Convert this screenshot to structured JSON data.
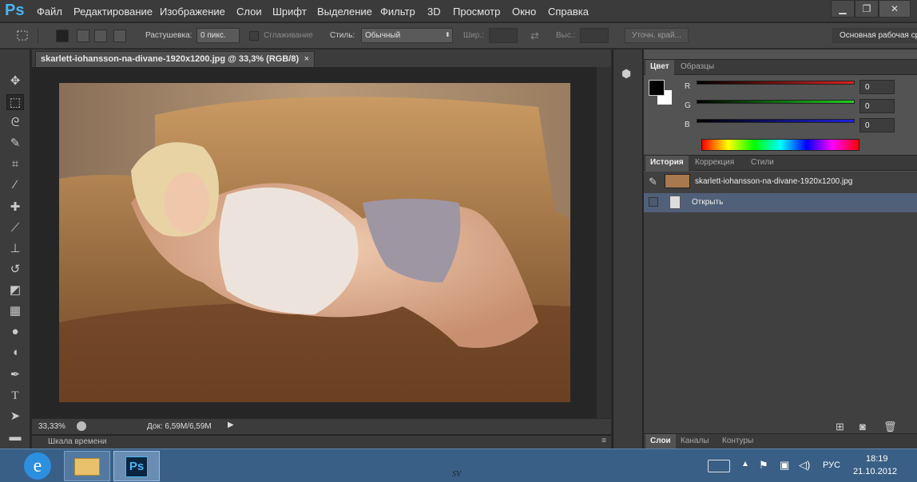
{
  "app": {
    "logo": "Ps"
  },
  "menu": [
    "Файл",
    "Редактирование",
    "Изображение",
    "Слои",
    "Шрифт",
    "Выделение",
    "Фильтр",
    "3D",
    "Просмотр",
    "Окно",
    "Справка"
  ],
  "window_controls": {
    "minimize": "▁",
    "restore": "❐",
    "close": "✕"
  },
  "options": {
    "feather_label": "Растушевка:",
    "feather_value": "0 пикс.",
    "antialias_label": "Сглаживание",
    "style_label": "Стиль:",
    "style_value": "Обычный",
    "width_label": "Шир.:",
    "height_label": "Выс.:",
    "refine_edge": "Уточн. край...",
    "workspace": "Основная рабочая ср"
  },
  "document": {
    "tab_title": "skarlett-iohansson-na-divane-1920x1200.jpg @ 33,3% (RGB/8)",
    "close": "×",
    "zoom": "33,33%",
    "doc_info": "Док: 6,59M/6,59M"
  },
  "timeline": {
    "label": "Шкала времени"
  },
  "color_panel": {
    "tabs": [
      "Цвет",
      "Образцы"
    ],
    "channels": [
      {
        "label": "R",
        "value": "0",
        "color": "#e02020"
      },
      {
        "label": "G",
        "value": "0",
        "color": "#20d020"
      },
      {
        "label": "B",
        "value": "0",
        "color": "#2020e0"
      }
    ]
  },
  "history_panel": {
    "tabs": [
      "История",
      "Коррекция",
      "Стили"
    ],
    "snapshot": "skarlett-iohansson-na-divane-1920x1200.jpg",
    "items": [
      "Открыть"
    ]
  },
  "layers_panel": {
    "tabs": [
      "Слои",
      "Каналы",
      "Контуры"
    ]
  },
  "taskbar": {
    "lang": "РУС",
    "time": "18:19",
    "date": "21.10.2012",
    "center_text": "SV",
    "ps_label": "Ps"
  },
  "icons": [
    "move-icon",
    "marquee-icon",
    "lasso-icon",
    "quick-select-icon",
    "crop-icon",
    "eyedropper-icon",
    "healing-icon",
    "brush-icon",
    "stamp-icon",
    "history-brush-icon",
    "eraser-icon",
    "gradient-icon",
    "blur-icon",
    "dodge-icon",
    "pen-icon",
    "type-icon",
    "path-select-icon",
    "shape-icon"
  ]
}
